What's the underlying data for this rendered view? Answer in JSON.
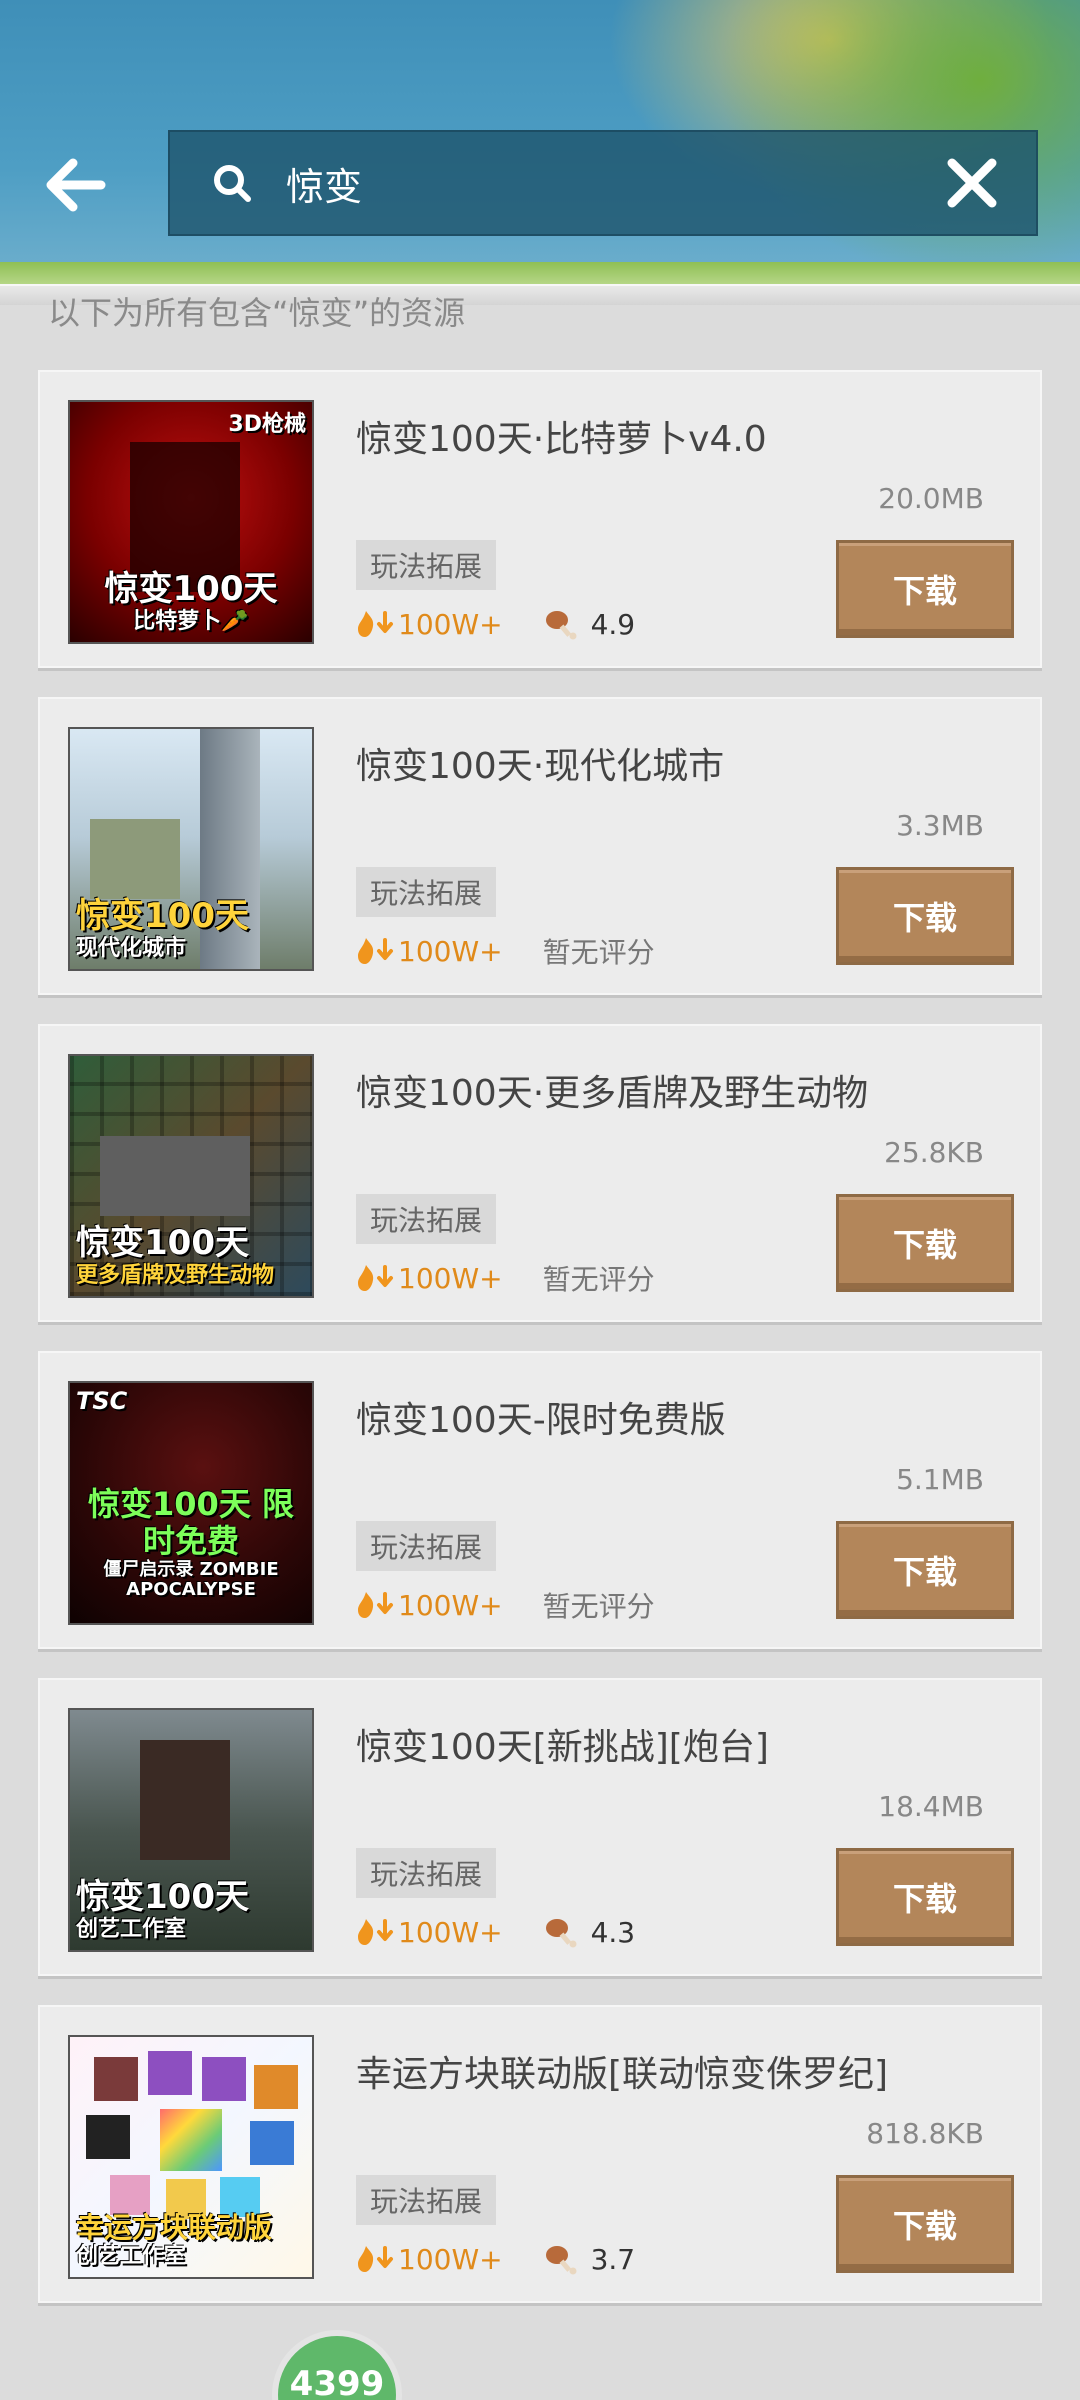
{
  "search": {
    "query": "惊变",
    "hint": "以下为所有包含“惊变”的资源"
  },
  "colors": {
    "header_blue": "#3f8fb8",
    "download_button": "#b3865a",
    "downloads_orange": "#e08a1a",
    "card_bg": "#ececec"
  },
  "items": [
    {
      "title": "惊变100天·比特萝卜v4.0",
      "size": "20.0MB",
      "tag": "玩法拓展",
      "downloads": "100W+",
      "rating": "4.9",
      "button": "下载",
      "thumb_icon": "thumbnail-image",
      "thumb_badge": "3D枪械",
      "thumb_line1": "惊变100天",
      "thumb_line2": "比特萝卜🥕"
    },
    {
      "title": "惊变100天·现代化城市",
      "size": "3.3MB",
      "tag": "玩法拓展",
      "downloads": "100W+",
      "rating": "暂无评分",
      "button": "下载",
      "thumb_icon": "thumbnail-image",
      "thumb_badge": "",
      "thumb_line1": "惊变100天",
      "thumb_line2": "现代化城市"
    },
    {
      "title": "惊变100天·更多盾牌及野生动物",
      "size": "25.8KB",
      "tag": "玩法拓展",
      "downloads": "100W+",
      "rating": "暂无评分",
      "button": "下载",
      "thumb_icon": "thumbnail-image",
      "thumb_badge": "",
      "thumb_line1": "惊变100天",
      "thumb_line2": "更多盾牌及野生动物"
    },
    {
      "title": "惊变100天-限时免费版",
      "size": "5.1MB",
      "tag": "玩法拓展",
      "downloads": "100W+",
      "rating": "暂无评分",
      "button": "下载",
      "thumb_icon": "thumbnail-image",
      "thumb_badge": "TSC",
      "thumb_line1": "惊变100天 限时免费",
      "thumb_line2": "僵尸启示录 ZOMBIE APOCALYPSE"
    },
    {
      "title": "惊变100天[新挑战][炮台]",
      "size": "18.4MB",
      "tag": "玩法拓展",
      "downloads": "100W+",
      "rating": "4.3",
      "button": "下载",
      "thumb_icon": "thumbnail-image",
      "thumb_badge": "",
      "thumb_line1": "惊变100天",
      "thumb_line2": "创艺工作室"
    },
    {
      "title": "幸运方块联动版[联动惊变侏罗纪]",
      "size": "818.8KB",
      "tag": "玩法拓展",
      "downloads": "100W+",
      "rating": "3.7",
      "button": "下载",
      "thumb_icon": "thumbnail-image",
      "thumb_badge": "",
      "thumb_line1": "幸运方块联动版",
      "thumb_line2": "创艺工作室"
    }
  ],
  "bottom_badge": "4399"
}
